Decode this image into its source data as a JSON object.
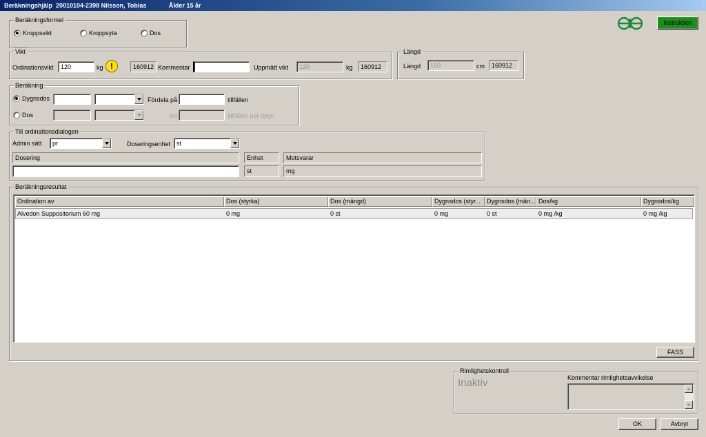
{
  "window": {
    "title": "Beräkningshjälp  20010104-2398 Nilsson, Tobias             Ålder 15 år"
  },
  "colors": {
    "instruction_bg": "#1a8f1a",
    "titlebar": "#0a246a",
    "warning": "#ffe400"
  },
  "formula": {
    "legend": "Beräkningsformel",
    "options": [
      "Kroppsvikt",
      "Kroppsyta",
      "Dos"
    ],
    "selected": "Kroppsvikt"
  },
  "buttons": {
    "instruction": "Instruktion",
    "fass": "FASS",
    "ok": "OK",
    "cancel": "Avbryt"
  },
  "weight": {
    "legend": "Vikt",
    "ordination_label": "Ordinationsvikt",
    "ordination_value": "120",
    "unit_kg": "kg",
    "warning_icon": "!",
    "date_code": "160912",
    "comment_label": "Kommentar",
    "comment_value": "",
    "measured_label": "Uppmätt vikt",
    "measured_value": "120",
    "measured_unit": "kg",
    "measured_date": "160912"
  },
  "length": {
    "legend": "Längd",
    "label": "Längd",
    "value": "160",
    "unit": "cm",
    "date": "160912"
  },
  "calc": {
    "legend": "Beräkning",
    "daily_label": "Dygnsdos",
    "daily_value": "",
    "daily_unit": "",
    "distribute_label": "Fördela på",
    "distribute_value": "",
    "times_label": "tillfällen",
    "dose_label": "Dos",
    "at_label": "vid",
    "times_per_day_label": "tillfällen per dygn",
    "selected": "Dygnsdos"
  },
  "dialog": {
    "legend": "Till ordinationsdialogen",
    "admin_label": "Admin sätt",
    "admin_value": "pr",
    "dose_unit_label": "Doseringsenhet",
    "dose_unit_value": "st",
    "dosering_header": "Dosering",
    "unit_header": "Enhet",
    "corresponds_header": "Motsvarar",
    "dosering_value": "",
    "unit_value": "st",
    "corresponds_value": "mg"
  },
  "results": {
    "legend": "Beräkningsresultat",
    "columns": [
      "Ordination av",
      "Dos (styrka)",
      "Dos (mängd)",
      "Dygnsdos (styr...",
      "Dygnsdos (män...",
      "Dos/kg",
      "Dygnsdos/kg"
    ],
    "rows": [
      [
        "Alvedon Suppositorium 60 mg",
        "0 mg",
        "0 st",
        "0 mg",
        "0 st",
        "0 mg /kg",
        "0 mg /kg"
      ]
    ]
  },
  "check": {
    "legend": "Rimlighetskontroll",
    "status": "Inaktiv",
    "comment_label": "Kommentar rimlighetsavvikelse"
  }
}
